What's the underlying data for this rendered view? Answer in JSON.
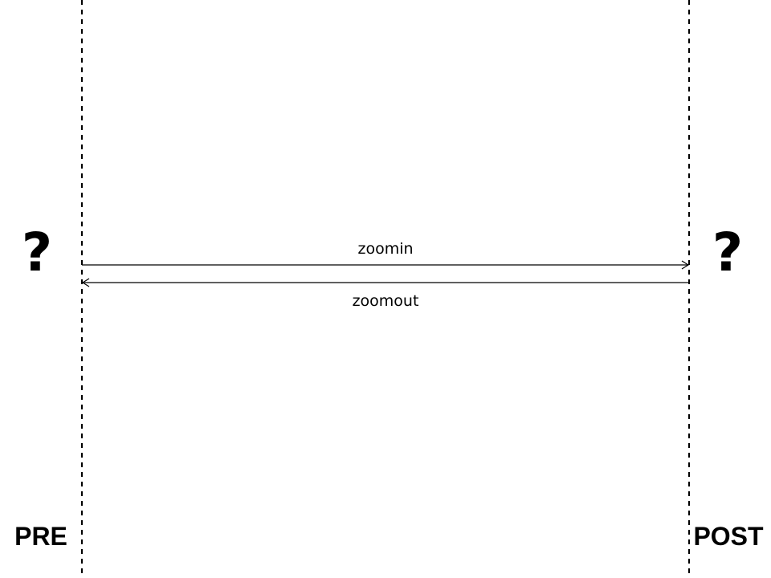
{
  "participants": {
    "left": "PRE",
    "right": "POST"
  },
  "states": {
    "left": "?",
    "right": "?"
  },
  "messages": [
    {
      "label": "zoomin",
      "direction": "left-to-right"
    },
    {
      "label": "zoomout",
      "direction": "right-to-left"
    }
  ]
}
